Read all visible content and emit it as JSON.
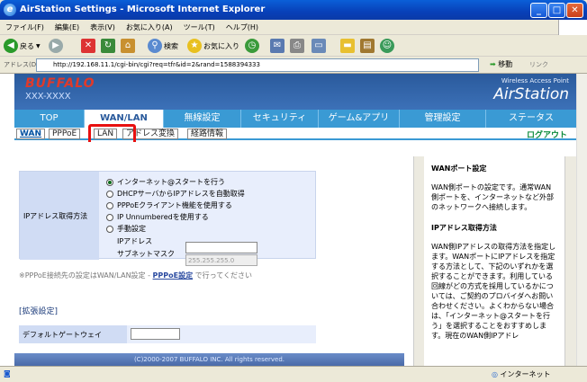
{
  "window": {
    "title": "AirStation Settings - Microsoft Internet Explorer",
    "min": "_",
    "max": "□",
    "close": "✕"
  },
  "menu": [
    "ファイル(F)",
    "編集(E)",
    "表示(V)",
    "お気に入り(A)",
    "ツール(T)",
    "ヘルプ(H)"
  ],
  "toolbar": {
    "back": "戻る",
    "search": "検索",
    "favorites": "お気に入り"
  },
  "address": {
    "label": "アドレス(D)",
    "url": "http://192.168.11.1/cgi-bin/cgi?req=tfr&id=2&rand=1588394333",
    "go": "移動",
    "links": "リンク"
  },
  "header": {
    "logo": "BUFFALO",
    "model": "XXX-XXXX",
    "wap": "Wireless Access Point",
    "brand": "AirStation"
  },
  "nav": [
    "TOP",
    "WAN/LAN",
    "無線設定",
    "セキュリティ",
    "ゲーム&アプリ",
    "管理設定",
    "ステータス"
  ],
  "subnav": [
    "WAN",
    "PPPoE",
    "LAN",
    "アドレス変換",
    "経路情報"
  ],
  "logout": "ログアウト",
  "form": {
    "label": "IPアドレス取得方法",
    "options": [
      "インターネット@スタートを行う",
      "DHCPサーバからIPアドレスを自動取得",
      "PPPoEクライアント機能を使用する",
      "IP Unnumberedを使用する",
      "手動設定"
    ],
    "ip_label": "IPアドレス",
    "mask_label": "サブネットマスク",
    "mask_value": "255.255.255.0"
  },
  "note": {
    "pre": "※PPPoE接続先の設定はWAN/LAN設定 -",
    "link": "PPPoE設定",
    "post": "で行ってください"
  },
  "ext": {
    "title": "[拡張設定]",
    "gateway": "デフォルトゲートウェイ"
  },
  "copyright": "(C)2000-2007 BUFFALO INC. All rights reserved.",
  "help": {
    "title1": "WANポート設定",
    "p1": "WAN側ポートの設定です。通常WAN側ポートを、インターネットなど外部のネットワークへ接続します。",
    "title2": "IPアドレス取得方法",
    "p2": "WAN側IPアドレスの取得方法を指定します。WANポートにIPアドレスを指定する方法として、下記のいずれかを選択することができます。利用している回線がどの方式を採用しているかについては、ご契約のプロバイダへお問い合わせください。よくわからない場合は、「インターネット@スタートを行う」を選択することをおすすめします。現在のWAN側IPアドレ"
  },
  "status": {
    "zone": "インターネット"
  }
}
